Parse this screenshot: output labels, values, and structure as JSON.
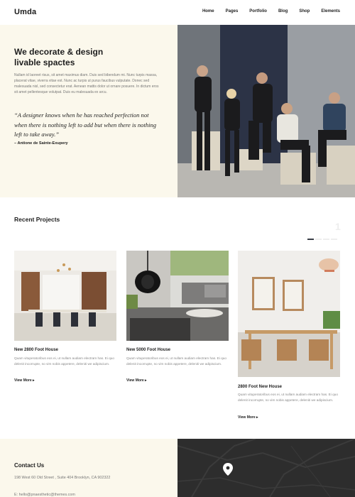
{
  "brand": {
    "logo": "Umda"
  },
  "nav": {
    "items": [
      "Home",
      "Pages",
      "Portfolio",
      "Blog",
      "Shop",
      "Elements"
    ]
  },
  "hero": {
    "title_line1": "We decorate & design",
    "title_line2": "livable spactes",
    "body": "Nullam id laoreet risus, sit amet maximus diam. Duis sed bibendum mi. Nunc turpis massa, placerat vitae, viverra vitae est. Nunc ac turpis ut purus faucibus vulputate. Donec sed malesuada nisl, sed consectetur erat. Aenean mattis dolor ut ornare posuere. In dictum eros sit amet pellentesque volutpat. Duis eu malesuada ex arcu.",
    "quote": "“A designer knows when he has reached perfection not when there is nothing left to add but when there is nothing left to take away.”",
    "author": "– Antione de Sainte-Exupery"
  },
  "projects": {
    "section_title": "Recent Projects",
    "slider_number": "1",
    "items": [
      {
        "title": "New 2800 Foot House",
        "desc": "Quam vituperatoribus eos ei, ut nullam audiam electram has. Ei quo delenit incorrupte, no vim nobis appetere, deleniti we adipiscium.",
        "more": "View More ▸"
      },
      {
        "title": "New 5000 Foot House",
        "desc": "Quam vituperatoribus eos ei, ut nullam audiam electram has. Ei quo delenit incorrupte, no vim nobis appetere, deleniti we adipiscium.",
        "more": "View More ▸"
      },
      {
        "title": "2800 Foot New House",
        "desc": "Quam vituperatoribus eos ei, ut nullam audiam electram has. Ei quo delenit incorrupte, no vim nobis appetere, deleniti we adipiscium.",
        "more": "View More ▸"
      }
    ]
  },
  "contact": {
    "title": "Contact Us",
    "address": "198 West 60 Old Street , Suite 404 Brooklyn, CA 902322",
    "email": "E: hello@pnaesthetic@themes.com"
  },
  "colors": {
    "cream": "#fbf8ec",
    "map_dark": "#2d2d2d",
    "accent_dark": "#3a3f47"
  }
}
